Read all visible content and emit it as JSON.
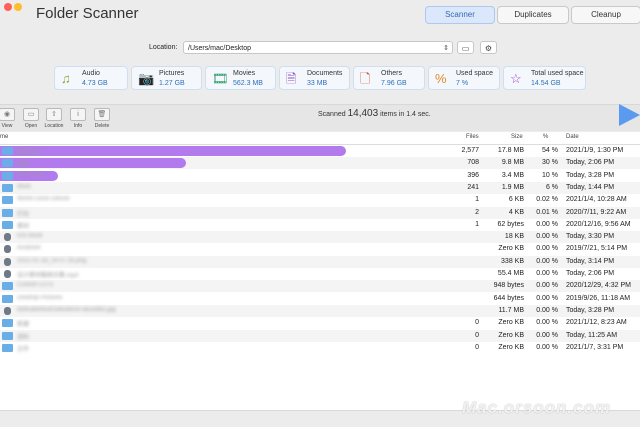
{
  "app": {
    "title": "Folder Scanner"
  },
  "window_controls": {
    "close_color": "#ff5f56",
    "minimize_color": "#ffbd2e",
    "zoom_color": "#27c93f"
  },
  "modes": [
    {
      "label": "Scanner",
      "active": true
    },
    {
      "label": "Duplicates",
      "active": false
    },
    {
      "label": "Cleanup",
      "active": false
    }
  ],
  "location": {
    "label": "Location:",
    "value": "/Users/mac/Desktop"
  },
  "categories": [
    {
      "name": "Audio",
      "value": "4.73 GB",
      "icon": "music-note-icon",
      "glyph": "♫",
      "color": "#8aa83a"
    },
    {
      "name": "Pictures",
      "value": "1.27 GB",
      "icon": "camera-icon",
      "glyph": "📷",
      "color": "#2b8fbf"
    },
    {
      "name": "Movies",
      "value": "562.3 MB",
      "icon": "film-icon",
      "glyph": "🎞",
      "color": "#2b9a6b"
    },
    {
      "name": "Documents",
      "value": "33 MB",
      "icon": "document-icon",
      "glyph": "🗎",
      "color": "#8b4fbf"
    },
    {
      "name": "Others",
      "value": "7.96 GB",
      "icon": "file-icon",
      "glyph": "🗋",
      "color": "#d0463b"
    },
    {
      "name": "Used space",
      "value": "7 %",
      "icon": "percent-icon",
      "glyph": "%",
      "color": "#e08a2e"
    },
    {
      "name": "Total used space",
      "value": "14.54 GB",
      "icon": "star-icon",
      "glyph": "☆",
      "color": "#9c3fc4"
    }
  ],
  "toolbar": [
    {
      "label": "View",
      "icon": "eye-icon",
      "glyph": "◉"
    },
    {
      "label": "Open",
      "icon": "open-icon",
      "glyph": "▭"
    },
    {
      "label": "Location",
      "icon": "location-icon",
      "glyph": "⇧"
    },
    {
      "label": "Info",
      "icon": "info-icon",
      "glyph": "i"
    },
    {
      "label": "Delete",
      "icon": "trash-icon",
      "glyph": "🗑"
    }
  ],
  "scan": {
    "prefix": "Scanned",
    "count": "14,403",
    "suffix": "items in 1.4 sec."
  },
  "columns": {
    "name": "me",
    "files": "Files",
    "size": "Size",
    "percent": "%",
    "date": "Date"
  },
  "accent_bar_color": "#b27aec",
  "rows": [
    {
      "kind": "folder",
      "name": "视频工作",
      "files": "2,577",
      "size": "17.8 MB",
      "pct": "54 %",
      "date": "2021/1/9, 1:30 PM",
      "bar": 0.54
    },
    {
      "kind": "folder",
      "name": "项目",
      "files": "708",
      "size": "9.8 MB",
      "pct": "30 %",
      "date": "Today, 2:06 PM",
      "bar": 0.29
    },
    {
      "kind": "folder",
      "name": "Pine Dock",
      "files": "396",
      "size": "3.4 MB",
      "pct": "10 %",
      "date": "Today, 3:28 PM",
      "bar": 0.09
    },
    {
      "kind": "folder",
      "name": "Work",
      "files": "241",
      "size": "1.9 MB",
      "pct": "6 %",
      "date": "Today, 1:44 PM",
      "bar": 0
    },
    {
      "kind": "folder",
      "name": "World Clock Deluxe",
      "files": "1",
      "size": "6 KB",
      "pct": "0.02 %",
      "date": "2021/1/4, 10:28 AM",
      "bar": 0
    },
    {
      "kind": "folder",
      "name": "打包",
      "files": "2",
      "size": "4 KB",
      "pct": "0.01 %",
      "date": "2020/7/11, 9:22 AM",
      "bar": 0
    },
    {
      "kind": "folder",
      "name": "素材",
      "files": "1",
      "size": "62 bytes",
      "pct": "0.00 %",
      "date": "2020/12/16, 9:56 AM",
      "bar": 0
    },
    {
      "kind": "file",
      "name": "iOS Book",
      "files": "",
      "size": "18 KB",
      "pct": "0.00 %",
      "date": "Today, 3:30 PM",
      "bar": 0
    },
    {
      "kind": "file",
      "name": "localized",
      "files": "",
      "size": "Zero KB",
      "pct": "0.00 %",
      "date": "2019/7/21, 5:14 PM",
      "bar": 0
    },
    {
      "kind": "file",
      "name": "2021-01-18_14.07.35.png",
      "files": "",
      "size": "338 KB",
      "pct": "0.00 %",
      "date": "Today, 3:14 PM",
      "bar": 0
    },
    {
      "kind": "file",
      "name": "设计素材截图合集.mp4",
      "files": "",
      "size": "55.4 MB",
      "pct": "0.00 %",
      "date": "Today, 2:06 PM",
      "bar": 0
    },
    {
      "kind": "folder",
      "name": "Custom LUTs",
      "files": "",
      "size": "948 bytes",
      "pct": "0.00 %",
      "date": "2020/12/29, 4:32 PM",
      "bar": 0
    },
    {
      "kind": "folder",
      "name": "Desktop Pictures",
      "files": "",
      "size": "644 bytes",
      "pct": "0.00 %",
      "date": "2019/9/26, 11:18 AM",
      "bar": 0
    },
    {
      "kind": "file",
      "name": "d5ffca6ef4c8f1b6c8e0d7a62e8b3.jpg",
      "files": "",
      "size": "11.7 MB",
      "pct": "0.00 %",
      "date": "Today, 3:28 PM",
      "bar": 0
    },
    {
      "kind": "folder",
      "name": "新建",
      "files": "0",
      "size": "Zero KB",
      "pct": "0.00 %",
      "date": "2021/1/12, 8:23 AM",
      "bar": 0
    },
    {
      "kind": "folder",
      "name": "资料",
      "files": "0",
      "size": "Zero KB",
      "pct": "0.00 %",
      "date": "Today, 11:25 AM",
      "bar": 0
    },
    {
      "kind": "folder",
      "name": "文件",
      "files": "0",
      "size": "Zero KB",
      "pct": "0.00 %",
      "date": "2021/1/7, 3:31 PM",
      "bar": 0
    }
  ],
  "watermark": "Mac.orsoon.com"
}
